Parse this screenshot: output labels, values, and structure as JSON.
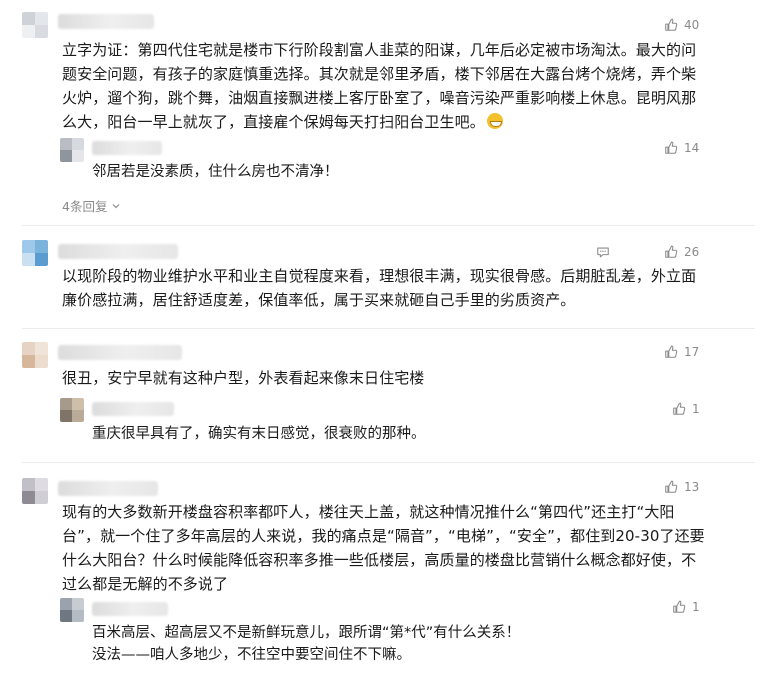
{
  "comments": [
    {
      "likes": "40",
      "text": "立字为证：第四代住宅就是楼市下行阶段割富人韭菜的阳谋，几年后必定被市场淘汰。最大的问题安全问题，有孩子的家庭慎重选择。其次就是邻里矛盾，楼下邻居在大露台烤个烧烤，弄个柴火炉，遛个狗，跳个舞，油烟直接飘进楼上客厅卧室了，噪音污染严重影响楼上休息。昆明风那么大，阳台一早上就灰了，直接雇个保姆每天打扫阳台卫生吧。",
      "emoji_icon": "grinning-emoji-icon",
      "reply": {
        "likes": "14",
        "text": "邻居若是没素质，住什么房也不清净！"
      },
      "more_replies": "4条回复"
    },
    {
      "likes": "26",
      "text": "以现阶段的物业维护水平和业主自觉程度来看，理想很丰满，现实很骨感。后期脏乱差，外立面廉价感拉满，居住舒适度差，保值率低，属于买来就砸自己手里的劣质资产。"
    },
    {
      "likes": "17",
      "text": "很丑，安宁早就有这种户型，外表看起来像末日住宅楼",
      "reply": {
        "likes": "1",
        "text": "重庆很早具有了，确实有末日感觉，很衰败的那种。"
      }
    },
    {
      "likes": "13",
      "text": "现有的大多数新开楼盘容积率都吓人，楼往天上盖，就这种情况推什么“第四代”还主打“大阳台”，就一个住了多年高层的人来说，我的痛点是“隔音”，“电梯”，“安全”，都住到20-30了还要什么大阳台？什么时候能降低容积率多推一些低楼层，高质量的楼盘比营销什么概念都好使，不过么都是无解的不多说了",
      "reply": {
        "likes": "1",
        "text_line1": "百米高层、超高层又不是新鲜玩意儿，跟所谓“第*代”有什么关系！",
        "text_line2": "没法——咱人多地少，不往空中要空间住不下嘛。"
      }
    }
  ],
  "icons": {
    "like": "thumbs-up-icon",
    "comment": "comment-bubble-icon",
    "more": "chevron-down-icon"
  },
  "colors": {
    "meta_text": "#8a8a8a",
    "body_text": "#1a1a1a",
    "divider": "#ececec"
  }
}
